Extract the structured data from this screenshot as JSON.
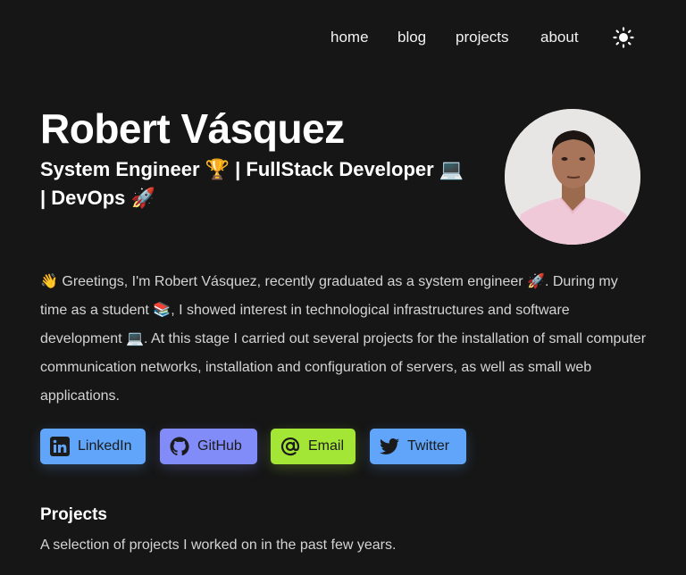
{
  "nav": {
    "items": [
      {
        "label": "home"
      },
      {
        "label": "blog"
      },
      {
        "label": "projects"
      },
      {
        "label": "about"
      }
    ],
    "theme_icon": "sun-icon"
  },
  "hero": {
    "name": "Robert Vásquez",
    "subtitle": "System Engineer 🏆 | FullStack Developer 💻 | DevOps 🚀",
    "avatar": "profile-photo"
  },
  "bio": "👋 Greetings, I'm Robert Vásquez, recently graduated as a system engineer 🚀. During my time as a student 📚, I showed interest in technological infrastructures and software development 💻. At this stage I carried out several projects for the installation of small computer communication networks, installation and configuration of servers, as well as small web applications.",
  "socials": [
    {
      "label": "LinkedIn",
      "icon": "linkedin-icon",
      "color": "#60a5fa"
    },
    {
      "label": "GitHub",
      "icon": "github-icon",
      "color": "#818cf8"
    },
    {
      "label": "Email",
      "icon": "at-sign-icon",
      "color": "#a3e635"
    },
    {
      "label": "Twitter",
      "icon": "twitter-icon",
      "color": "#60a5fa"
    }
  ],
  "projects": {
    "title": "Projects",
    "description": "A selection of projects I worked on in the past few years."
  },
  "colors": {
    "background": "#161616",
    "text": "#ffffff",
    "muted_text": "#d4d4d4"
  }
}
